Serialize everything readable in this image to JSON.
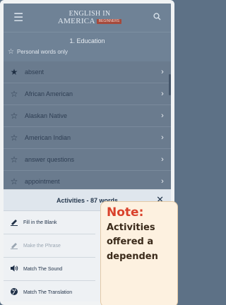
{
  "header": {
    "menu_icon": "hamburger-icon",
    "logo_line1": "ENGLISH IN",
    "logo_line2": "AMERICA",
    "logo_badge": "BEGINNERS",
    "search_icon": "search-icon"
  },
  "section": {
    "title": "1. Education",
    "filter_label": "Personal words only"
  },
  "words": [
    {
      "label": "absent",
      "starred": true
    },
    {
      "label": "African American",
      "starred": false
    },
    {
      "label": "Alaskan Native",
      "starred": false
    },
    {
      "label": "American Indian",
      "starred": false
    },
    {
      "label": "answer questions",
      "starred": false
    },
    {
      "label": "appointment",
      "starred": false
    }
  ],
  "activities": {
    "title": "Activities - 87 words",
    "close_icon": "close-icon",
    "items": [
      {
        "label": "Fill in the Blank",
        "icon": "pencil-icon",
        "enabled": true
      },
      {
        "label": "Make the Phrase",
        "icon": "pencil-icon",
        "enabled": false
      },
      {
        "label": "Match The Sound",
        "icon": "speaker-icon",
        "enabled": true
      },
      {
        "label": "Match The Translation",
        "icon": "globe-icon",
        "enabled": true
      }
    ]
  },
  "note": {
    "title": "Note:",
    "line1": "Activities",
    "line2": "offered a",
    "line3": "dependen"
  },
  "colors": {
    "accent": "#a64a3c",
    "note_title": "#d9412b",
    "panel_bg": "#eef1f4"
  }
}
